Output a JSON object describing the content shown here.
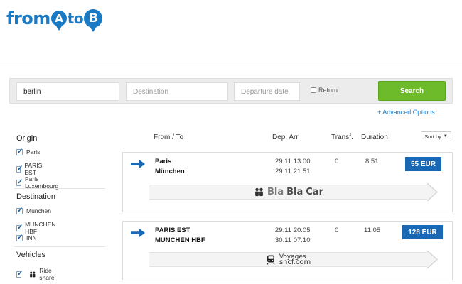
{
  "logo": {
    "part1": "from",
    "a": "A",
    "to": "to",
    "b": "B"
  },
  "search": {
    "origin_value": "berlin",
    "destination_placeholder": "Destination",
    "date_placeholder": "Departure date",
    "return_label": "Return",
    "search_button": "Search",
    "advanced_link": "+ Advanced Options"
  },
  "sidebar": {
    "origin_title": "Origin",
    "origin_items": [
      "Paris",
      "PARIS EST",
      "Paris Luxembourg"
    ],
    "destination_title": "Destination",
    "destination_items": [
      "München",
      "MUNCHEN HBF",
      "INN"
    ],
    "vehicles_title": "Vehicles",
    "vehicle_items": [
      "Ride share"
    ]
  },
  "results_header": {
    "from_to": "From / To",
    "dep_arr": "Dep. Arr.",
    "transfers": "Transf.",
    "duration": "Duration",
    "sort_by": "Sort by"
  },
  "results": [
    {
      "from": "Paris",
      "to": "München",
      "dep": "29.11 13:00",
      "arr": "29.11 21:51",
      "transfers": "0",
      "duration": "8:51",
      "price": "55 EUR",
      "provider": {
        "part1": "Bla",
        "part2": "Bla",
        "part3": "Car"
      }
    },
    {
      "from": "PARIS EST",
      "to": "MUNCHEN HBF",
      "dep": "29.11 20:05",
      "arr": "30.11 07:10",
      "transfers": "0",
      "duration": "11:05",
      "price": "128 EUR",
      "provider": {
        "line1": "Voyages",
        "line2": "sncf.com"
      }
    }
  ],
  "colors": {
    "brand_blue": "#1a7ac4",
    "price_blue": "#1a67b3",
    "search_green": "#6dbb2a"
  },
  "icons": {
    "result_arrow": "arrow-right-icon",
    "ride_share": "people-icon",
    "train": "train-icon",
    "sort": "caret-down-icon"
  }
}
